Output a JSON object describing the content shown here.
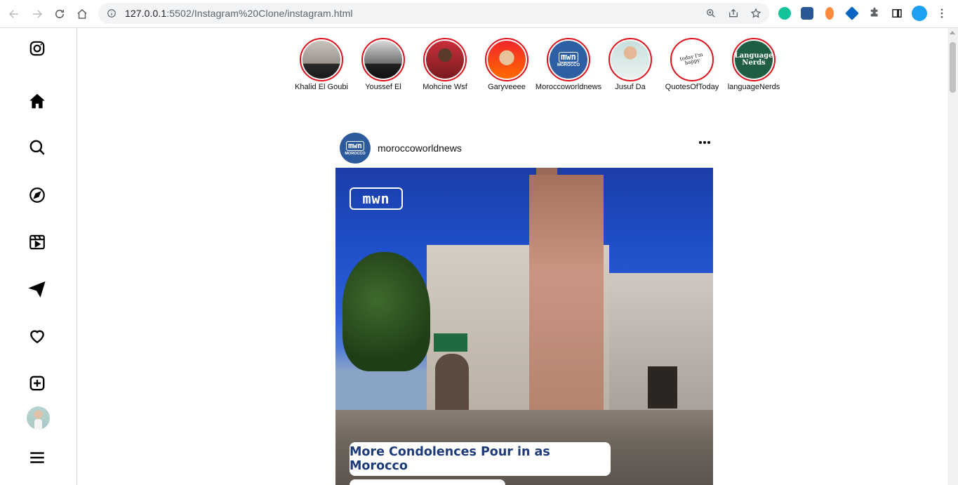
{
  "browser": {
    "url_host": "127.0.0.1",
    "url_rest": ":5502/Instagram%20Clone/instagram.html",
    "icons": [
      "back-icon",
      "forward-icon",
      "reload-icon",
      "home-icon",
      "info-icon",
      "zoom-icon",
      "share-icon",
      "bookmark-star-icon",
      "extensions-icon",
      "side-panel-icon",
      "menu-kebab-icon"
    ],
    "extension_colors": [
      "#15c39a",
      "#2b5797",
      "#ff8a3d",
      "#0a66c2"
    ]
  },
  "sidebar": {
    "items": [
      {
        "name": "instagram-logo-icon"
      },
      {
        "name": "home-icon"
      },
      {
        "name": "search-icon"
      },
      {
        "name": "explore-icon"
      },
      {
        "name": "reels-icon"
      },
      {
        "name": "messages-icon"
      },
      {
        "name": "notifications-icon"
      },
      {
        "name": "create-icon"
      },
      {
        "name": "profile-avatar"
      },
      {
        "name": "more-menu-icon"
      }
    ]
  },
  "stories": [
    {
      "name": "Khalid El Goubi"
    },
    {
      "name": "Youssef El"
    },
    {
      "name": "Mohcine Wsf"
    },
    {
      "name": "Garyveeee"
    },
    {
      "name": "Moroccoworldnews"
    },
    {
      "name": "Jusuf Da"
    },
    {
      "name": "QuotesOfToday"
    },
    {
      "name": "languageNerds"
    }
  ],
  "story_images": {
    "mwn_logo": "mwn",
    "mwn_sub": "MOROCCO",
    "quotes_text": "today I'm happy",
    "language_text": "Language Nerds"
  },
  "post": {
    "username": "moroccoworldnews",
    "avatar_logo": "mwn",
    "avatar_sub": "MOROCCO",
    "image_logo": "mwn",
    "headline": "More Condolences Pour in as Morocco"
  },
  "colors": {
    "story_ring": "#e0101a",
    "headline_text": "#1e3a78"
  }
}
